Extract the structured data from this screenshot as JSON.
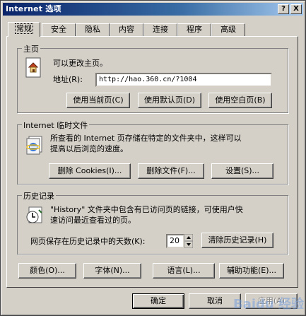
{
  "window": {
    "title": "Internet 选项",
    "help_button": "?",
    "close_button": "X"
  },
  "tabs": [
    {
      "label": "常规",
      "active": true
    },
    {
      "label": "安全"
    },
    {
      "label": "隐私"
    },
    {
      "label": "内容"
    },
    {
      "label": "连接"
    },
    {
      "label": "程序"
    },
    {
      "label": "高级"
    }
  ],
  "homepage": {
    "legend": "主页",
    "description": "可以更改主页。",
    "address_label": "地址(R):",
    "address_value": "http://hao.360.cn/?1004",
    "use_current": "使用当前页(C)",
    "use_default": "使用默认页(D)",
    "use_blank": "使用空白页(B)"
  },
  "temp_files": {
    "legend": "Internet 临时文件",
    "description_line1": "所查看的 Internet 页存储在特定的文件夹中，这样可以",
    "description_line2": "提高以后浏览的速度。",
    "delete_cookies": "删除 Cookies(I)...",
    "delete_files": "删除文件(F)...",
    "settings": "设置(S)..."
  },
  "history": {
    "legend": "历史记录",
    "description_line1": "\"History\" 文件夹中包含有已访问页的链接，可使用户快",
    "description_line2": "速访问最近查看过的页。",
    "days_label": "网页保存在历史记录中的天数(K):",
    "days_value": "20",
    "clear_history": "清除历史记录(H)"
  },
  "bottom_buttons": {
    "colors": "颜色(O)...",
    "fonts": "字体(N)...",
    "languages": "语言(L)...",
    "accessibility": "辅助功能(E)..."
  },
  "dialog_buttons": {
    "ok": "确定",
    "cancel": "取消",
    "apply": "应用(A)"
  },
  "watermark": "Baidu 经验"
}
